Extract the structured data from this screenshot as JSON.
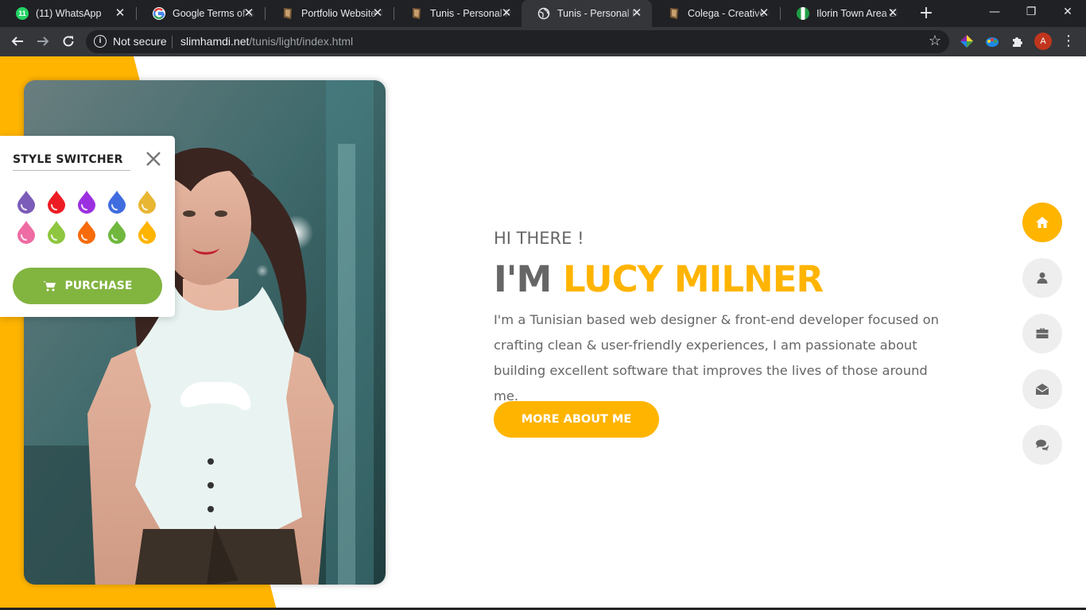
{
  "browser": {
    "tabs": [
      {
        "title": "(11) WhatsApp",
        "favicon": "whatsapp-icon",
        "badge": "11",
        "color": "#25d366"
      },
      {
        "title": "Google Terms of S",
        "favicon": "google-icon",
        "color": "#ffffff"
      },
      {
        "title": "Portfolio Website T",
        "favicon": "themeforest-icon",
        "color": "#7b5a38"
      },
      {
        "title": "Tunis - Personal Po",
        "favicon": "themeforest-icon",
        "color": "#7b5a38"
      },
      {
        "title": "Tunis - Personal Po",
        "favicon": "globe-icon",
        "color": "#e8eaed",
        "active": true
      },
      {
        "title": "Colega - Creative P",
        "favicon": "themeforest-icon",
        "color": "#7b5a38"
      },
      {
        "title": "Ilorin Town Area Zi",
        "favicon": "nigeria-flag-icon",
        "color": "#1f9e45"
      }
    ],
    "new_tab": "+",
    "window_controls": {
      "minimize": "—",
      "restore": "❐",
      "close": "✕"
    },
    "security_label": "Not secure",
    "url_host": "slimhamdi.net",
    "url_path": "/tunis/light/index.html",
    "profile_initial": "A"
  },
  "style_switcher": {
    "title": "STYLE SWITCHER",
    "colors": [
      "#7b5cb8",
      "#ed1c24",
      "#9b30e0",
      "#3f6de0",
      "#e8b632",
      "#ee6ba3",
      "#8ec63f",
      "#f76b0a",
      "#6fb73d",
      "#ffb400"
    ],
    "purchase_label": "PURCHASE"
  },
  "hero": {
    "greeting": "HI THERE !",
    "name_prefix": "I'M ",
    "name_highlight": "LUCY MILNER",
    "bio": "I'm a Tunisian based web designer & front-end developer focused on crafting clean & user-friendly experiences, I am passionate about building excellent software that improves the lives of those around me.",
    "cta_label": "MORE ABOUT ME"
  },
  "side_nav": [
    {
      "name": "home-icon",
      "active": true
    },
    {
      "name": "user-icon",
      "active": false
    },
    {
      "name": "briefcase-icon",
      "active": false
    },
    {
      "name": "envelope-open-icon",
      "active": false
    },
    {
      "name": "comments-icon",
      "active": false
    }
  ],
  "theme": {
    "accent": "#ffb400",
    "purchase": "#82b440"
  }
}
